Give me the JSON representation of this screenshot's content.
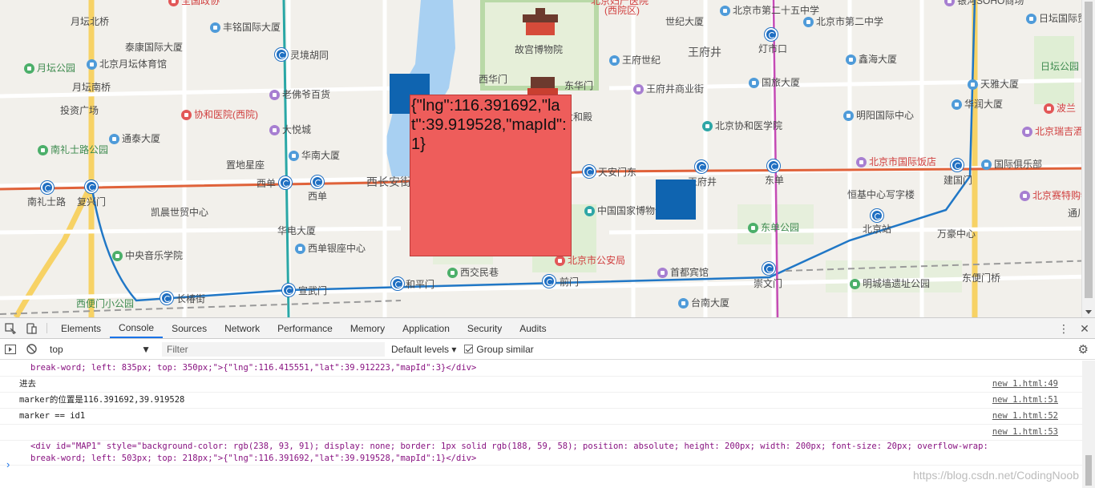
{
  "map": {
    "labels": [
      {
        "t": "全国政协",
        "cls": "red",
        "ico": "red"
      },
      {
        "t": "月坛北桥",
        "cls": "",
        "ico": ""
      },
      {
        "t": "丰铭国际大厦",
        "cls": "",
        "ico": "blue"
      },
      {
        "t": "泰康国际大厦",
        "cls": "",
        "ico": ""
      },
      {
        "t": "灵境胡同",
        "cls": "",
        "ico": ""
      },
      {
        "t": "北京月坛体育馆",
        "cls": "",
        "ico": "blue"
      },
      {
        "t": "月坛公园",
        "cls": "green",
        "ico": "green"
      },
      {
        "t": "月坛南桥",
        "cls": "",
        "ico": ""
      },
      {
        "t": "老佛爷百货",
        "cls": "",
        "ico": "purple"
      },
      {
        "t": "投资广场",
        "cls": "",
        "ico": ""
      },
      {
        "t": "协和医院(西院)",
        "cls": "red",
        "ico": "red"
      },
      {
        "t": "大悦城",
        "cls": "",
        "ico": "purple"
      },
      {
        "t": "南礼士路公园",
        "cls": "green",
        "ico": "green"
      },
      {
        "t": "通泰大厦",
        "cls": "",
        "ico": "blue"
      },
      {
        "t": "华南大厦",
        "cls": "",
        "ico": "blue"
      },
      {
        "t": "置地星座",
        "cls": "",
        "ico": ""
      },
      {
        "t": "西单",
        "cls": "",
        "ico": ""
      },
      {
        "t": "西单",
        "cls": "",
        "ico": ""
      },
      {
        "t": "西长安街",
        "cls": "big",
        "ico": ""
      },
      {
        "t": "南礼士路",
        "cls": "",
        "ico": ""
      },
      {
        "t": "复兴门",
        "cls": "",
        "ico": ""
      },
      {
        "t": "凯晨世贸中心",
        "cls": "",
        "ico": ""
      },
      {
        "t": "华电大厦",
        "cls": "",
        "ico": ""
      },
      {
        "t": "西单银座中心",
        "cls": "",
        "ico": "blue"
      },
      {
        "t": "中央音乐学院",
        "cls": "",
        "ico": "green"
      },
      {
        "t": "西交民巷",
        "cls": "",
        "ico": "green"
      },
      {
        "t": "长椿街",
        "cls": "",
        "ico": ""
      },
      {
        "t": "宣武门",
        "cls": "",
        "ico": ""
      },
      {
        "t": "和平门",
        "cls": "",
        "ico": ""
      },
      {
        "t": "前门",
        "cls": "",
        "ico": ""
      },
      {
        "t": "西便门小公园",
        "cls": "green",
        "ico": ""
      },
      {
        "t": "故宫博物院",
        "cls": "",
        "ico": ""
      },
      {
        "t": "西华门",
        "cls": "",
        "ico": ""
      },
      {
        "t": "东华门",
        "cls": "",
        "ico": ""
      },
      {
        "t": "太和殿",
        "cls": "",
        "ico": ""
      },
      {
        "t": "北京妇产医院",
        "cls": "red",
        "ico": ""
      },
      {
        "t": "天安门东",
        "cls": "",
        "ico": ""
      },
      {
        "t": "中国国家博物馆",
        "cls": "",
        "ico": "teal"
      },
      {
        "t": "北京市公安局",
        "cls": "red",
        "ico": "red"
      },
      {
        "t": "世纪大厦",
        "cls": "",
        "ico": ""
      },
      {
        "t": "北京市第二十五中学",
        "cls": "",
        "ico": "blue"
      },
      {
        "t": "北京市第二中学",
        "cls": "",
        "ico": "blue"
      },
      {
        "t": "灯市口",
        "cls": "",
        "ico": ""
      },
      {
        "t": "王府井",
        "cls": "big",
        "ico": ""
      },
      {
        "t": "王府世纪",
        "cls": "",
        "ico": "blue"
      },
      {
        "t": "鑫海大厦",
        "cls": "",
        "ico": "blue"
      },
      {
        "t": "国旅大厦",
        "cls": "",
        "ico": "blue"
      },
      {
        "t": "王府井商业街",
        "cls": "",
        "ico": "purple"
      },
      {
        "t": "华润大厦",
        "cls": "",
        "ico": "blue"
      },
      {
        "t": "明阳国际中心",
        "cls": "",
        "ico": "blue"
      },
      {
        "t": "北京协和医学院",
        "cls": "",
        "ico": "teal"
      },
      {
        "t": "北京市国际饭店",
        "cls": "red",
        "ico": "purple"
      },
      {
        "t": "国际俱乐部",
        "cls": "",
        "ico": "blue"
      },
      {
        "t": "王府井",
        "cls": "",
        "ico": ""
      },
      {
        "t": "东单",
        "cls": "",
        "ico": ""
      },
      {
        "t": "恒基中心写字楼",
        "cls": "",
        "ico": ""
      },
      {
        "t": "建国门",
        "cls": "",
        "ico": ""
      },
      {
        "t": "北京站",
        "cls": "",
        "ico": ""
      },
      {
        "t": "东单公园",
        "cls": "green",
        "ico": "green"
      },
      {
        "t": "万豪中心",
        "cls": "",
        "ico": ""
      },
      {
        "t": "首都宾馆",
        "cls": "",
        "ico": "purple"
      },
      {
        "t": "崇文门",
        "cls": "",
        "ico": ""
      },
      {
        "t": "明城墙遗址公园",
        "cls": "",
        "ico": "green"
      },
      {
        "t": "东便门桥",
        "cls": "",
        "ico": ""
      },
      {
        "t": "台南大厦",
        "cls": "",
        "ico": "blue"
      },
      {
        "t": "日坛国际贸易中心",
        "cls": "",
        "ico": "blue"
      },
      {
        "t": "日坛公园",
        "cls": "green",
        "ico": ""
      },
      {
        "t": "天雅大厦",
        "cls": "",
        "ico": "blue"
      },
      {
        "t": "波兰",
        "cls": "red",
        "ico": "red"
      },
      {
        "t": "北京瑞吉酒",
        "cls": "red",
        "ico": "purple"
      },
      {
        "t": "北京赛特购物中心",
        "cls": "red",
        "ico": "purple"
      },
      {
        "t": "通川",
        "cls": "",
        "ico": ""
      },
      {
        "t": "(西院区)",
        "cls": "red",
        "ico": ""
      },
      {
        "t": "银河SOHO商场",
        "cls": "",
        "ico": "purple"
      }
    ],
    "popup_text": "{\"lng\":116.391692,\"lat\":39.919528,\"mapId\":1}"
  },
  "devtools": {
    "tabs": [
      "Elements",
      "Console",
      "Sources",
      "Network",
      "Performance",
      "Memory",
      "Application",
      "Security",
      "Audits"
    ],
    "active_tab": "Console",
    "context": "top",
    "filter_placeholder": "Filter",
    "levels": "Default levels ▾",
    "group_similar": "Group similar",
    "lines": [
      {
        "text": "break-word; left: 835px; top: 350px;\">{\"lng\":116.415551,\"lat\":39.912223,\"mapId\":3}</div>",
        "src": ""
      },
      {
        "text": "进去",
        "src": "new 1.html:49"
      },
      {
        "text": "marker的位置是116.391692,39.919528",
        "src": "new 1.html:51"
      },
      {
        "text": "marker == id1",
        "src": "new 1.html:52"
      },
      {
        "text": "",
        "src": "new 1.html:53"
      }
    ],
    "element_line1": "<div id=\"MAP1\" style=\"background-color: rgb(238, 93, 91); display: none; border: 1px solid rgb(188, 59, 58); position: absolute; height: 200px; width: 200px; font-size: 20px; overflow-wrap:",
    "element_line2": "break-word; left: 503px; top: 218px;\">{\"lng\":116.391692,\"lat\":39.919528,\"mapId\":1}</div>",
    "prompt": "›",
    "watermark": "https://blog.csdn.net/CodingNoob"
  }
}
